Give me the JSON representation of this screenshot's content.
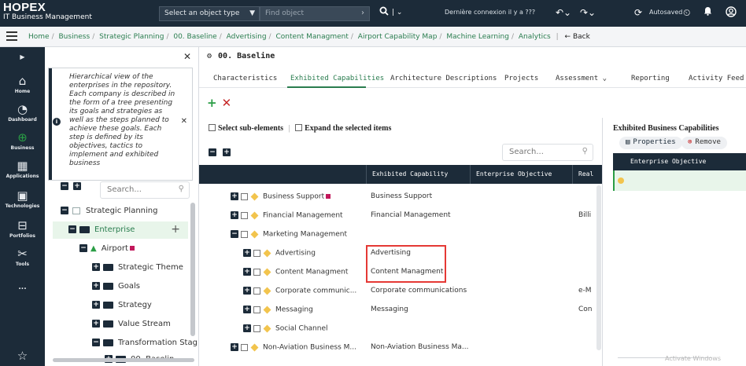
{
  "header": {
    "brand": "HOPEX",
    "subtitle": "IT Business Management",
    "object_type_select": "Select an object type",
    "find_object_placeholder": "Find object",
    "last_connection": "Dernière connexion il y a ???",
    "autosaved": "Autosaved"
  },
  "breadcrumb": {
    "items": [
      "Home",
      "Business",
      "Strategic Planning",
      "00. Baseline",
      "Advertising",
      "Content Managment",
      "Airport Capability Map",
      "Machine Learning",
      "Analytics"
    ],
    "back_label": "Back"
  },
  "leftnav": {
    "items": [
      {
        "label": "Home",
        "icon": "home-icon"
      },
      {
        "label": "Dashboard",
        "icon": "dashboard-icon"
      },
      {
        "label": "Business",
        "icon": "globe-icon"
      },
      {
        "label": "Applications",
        "icon": "applications-icon"
      },
      {
        "label": "Technologies",
        "icon": "chip-icon"
      },
      {
        "label": "Portfolios",
        "icon": "portfolio-icon"
      },
      {
        "label": "Tools",
        "icon": "tools-icon"
      },
      {
        "label": "...",
        "icon": "more-icon"
      }
    ],
    "favorite_icon": "star-icon"
  },
  "tree": {
    "help_text": "Hierarchical view of the enterprises in the repository. Each company is described in the form of a tree presenting its goals and strategies as well as the steps planned to achieve these goals. Each step is defined by its objectives, tactics to implement and exhibited business",
    "search_placeholder": "Search...",
    "nodes": [
      {
        "label": "Strategic Planning"
      },
      {
        "label": "Enterprise"
      },
      {
        "label": "Airport"
      },
      {
        "label": "Strategic Theme"
      },
      {
        "label": "Goals"
      },
      {
        "label": "Strategy"
      },
      {
        "label": "Value Stream"
      },
      {
        "label": "Transformation Stag"
      },
      {
        "label": "00. Baselin"
      }
    ]
  },
  "main": {
    "object_title": "00. Baseline",
    "tabs": [
      "Characteristics",
      "Exhibited Capabilities",
      "Architecture Descriptions",
      "Projects",
      "Assessment",
      "Reporting",
      "Activity Feed"
    ],
    "active_tab": "Exhibited Capabilities",
    "select_sub_elements": "Select sub-elements",
    "expand_selected": "Expand the selected items",
    "grid_search_placeholder": "Search...",
    "columns": [
      "Exhibited Capability",
      "Enterprise Objective",
      "Real"
    ],
    "rows": [
      {
        "name": "Business Support",
        "capability": "Business Support",
        "real": ""
      },
      {
        "name": "Financial Management",
        "capability": "Financial Management",
        "real": "Billi"
      },
      {
        "name": "Marketing Management",
        "capability": "",
        "real": ""
      },
      {
        "name": "Advertising",
        "capability": "Advertising",
        "real": ""
      },
      {
        "name": "Content Managment",
        "capability": "Content Managment",
        "real": ""
      },
      {
        "name": "Corporate communic...",
        "capability": "Corporate communications",
        "real": "e-M"
      },
      {
        "name": "Messaging",
        "capability": "Messaging",
        "real": "Con"
      },
      {
        "name": "Social Channel",
        "capability": "",
        "real": ""
      },
      {
        "name": "Non-Aviation Business M...",
        "capability": "Non-Aviation Business Ma...",
        "real": ""
      }
    ]
  },
  "right_panel": {
    "title": "Exhibited Business Capabilities",
    "properties_label": "Properties",
    "remove_label": "Remove",
    "column": "Enterprise Objective"
  },
  "watermark": "Activate Windows",
  "colors": {
    "nav_dark": "#1c2b39",
    "accent_green": "#2a7d4f",
    "highlight_red": "#e53935",
    "item_yellow": "#f2c44d"
  }
}
